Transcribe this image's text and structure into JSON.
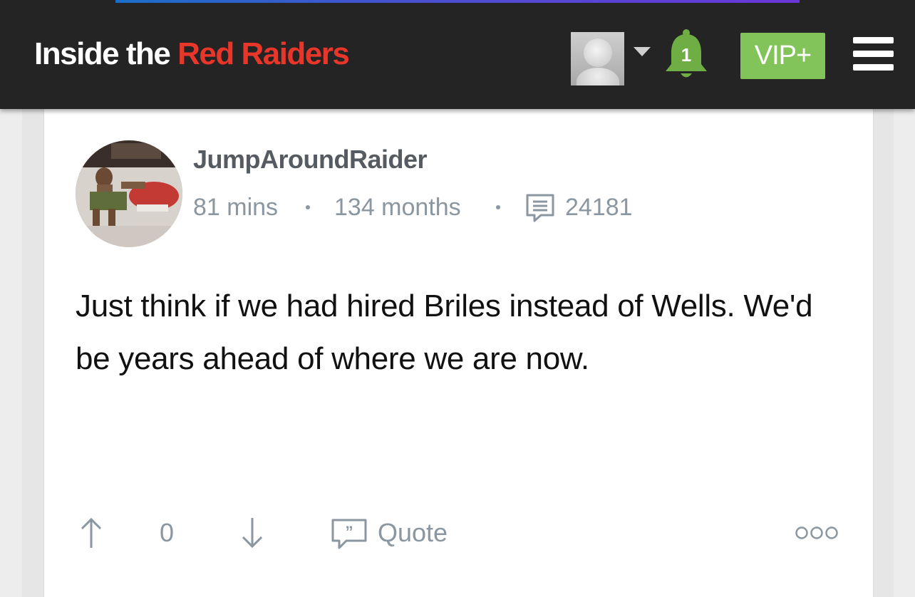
{
  "header": {
    "logo_part1": "Inside the ",
    "logo_part2": "Red Raiders",
    "notification_count": "1",
    "vip_label": "VIP+",
    "accent_colors": {
      "header_bg": "#242424",
      "logo_red": "#e8362a",
      "vip_green": "#82c45a",
      "bell_green": "#6fae45"
    }
  },
  "post": {
    "username": "JumpAroundRaider",
    "time_ago": "81 mins",
    "member_for": "134 months",
    "post_count": "24181",
    "body": "Just think if we had hired Briles instead of Wells. We'd be years ahead of where we are now.",
    "vote_count": "0",
    "quote_label": "Quote"
  },
  "icons": [
    "bell-icon",
    "menu-icon",
    "caret-down-icon",
    "comment-icon",
    "upvote-arrow-icon",
    "downvote-arrow-icon",
    "quote-icon",
    "more-options-icon"
  ]
}
